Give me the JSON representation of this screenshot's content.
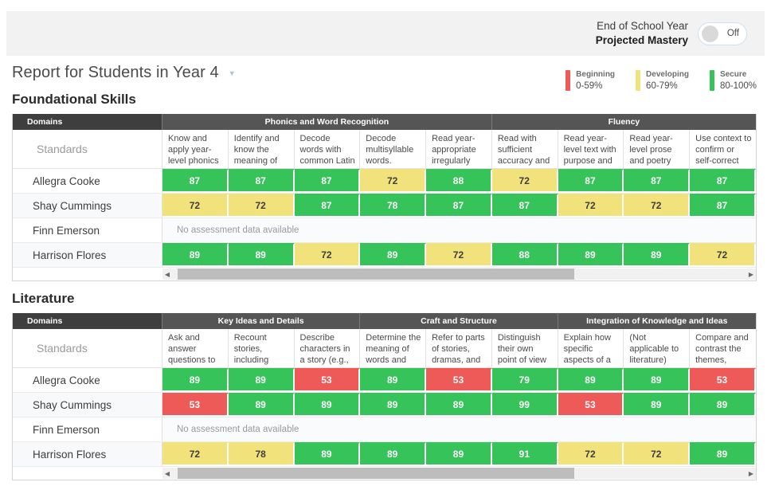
{
  "header": {
    "toggle_line1": "End of School Year",
    "toggle_line2": "Projected Mastery",
    "toggle_state": "Off"
  },
  "page_title": "Report for Students in Year 4",
  "legend": [
    {
      "name": "Beginning",
      "range": "0-59%",
      "color": "#ee5a58"
    },
    {
      "name": "Developing",
      "range": "60-79%",
      "color": "#f2e27c"
    },
    {
      "name": "Secure",
      "range": "80-100%",
      "color": "#35c35a"
    }
  ],
  "domains_header": "Domains",
  "standards_label": "Standards",
  "no_data_text": "No assessment data available",
  "sections": [
    {
      "title": "Foundational Skills",
      "groups": [
        {
          "label": "Phonics and Word Recognition",
          "span": 5
        },
        {
          "label": "Fluency",
          "span": 4
        }
      ],
      "standards": [
        "Know and apply year-level phonics",
        "Identify and know the meaning of",
        "Decode words with common Latin suffixes.",
        "Decode multisyllable words.",
        "Read year-appropriate irregularly",
        "Read with sufficient accuracy and",
        "Read year-level text with purpose and",
        "Read year-level prose and poetry",
        "Use context to confirm or self-correct"
      ],
      "rows": [
        {
          "name": "Allegra Cooke",
          "no_data": false,
          "scores": [
            87,
            87,
            87,
            72,
            88,
            72,
            87,
            87,
            87
          ],
          "levels": [
            "g",
            "g",
            "g",
            "y",
            "g",
            "y",
            "g",
            "g",
            "g"
          ]
        },
        {
          "name": "Shay Cummings",
          "no_data": false,
          "scores": [
            72,
            72,
            87,
            78,
            87,
            87,
            72,
            72,
            87
          ],
          "levels": [
            "y",
            "y",
            "g",
            "g",
            "g",
            "g",
            "y",
            "y",
            "g"
          ]
        },
        {
          "name": "Finn Emerson",
          "no_data": true,
          "scores": [],
          "levels": []
        },
        {
          "name": "Harrison Flores",
          "no_data": false,
          "scores": [
            89,
            89,
            72,
            89,
            72,
            88,
            89,
            89,
            72
          ],
          "levels": [
            "g",
            "g",
            "y",
            "g",
            "y",
            "g",
            "g",
            "g",
            "y"
          ]
        }
      ],
      "scroll": {
        "thumb_left_pct": 1,
        "thumb_width_pct": 69
      }
    },
    {
      "title": "Literature",
      "groups": [
        {
          "label": "Key Ideas and Details",
          "span": 3
        },
        {
          "label": "Craft and Structure",
          "span": 3
        },
        {
          "label": "Integration of Knowledge and Ideas",
          "span": 3
        }
      ],
      "standards": [
        "Ask and answer questions to",
        "Recount stories, including",
        "Describe characters in a story (e.g.,",
        "Determine the meaning of words and",
        "Refer to parts of stories, dramas, and",
        "Distinguish their own point of view",
        "Explain how specific aspects of a",
        "(Not applicable to literature)",
        "Compare and contrast the themes,"
      ],
      "rows": [
        {
          "name": "Allegra Cooke",
          "no_data": false,
          "scores": [
            89,
            89,
            53,
            89,
            53,
            79,
            89,
            89,
            53
          ],
          "levels": [
            "g",
            "g",
            "r",
            "g",
            "r",
            "g",
            "g",
            "g",
            "r"
          ]
        },
        {
          "name": "Shay Cummings",
          "no_data": false,
          "scores": [
            53,
            89,
            89,
            89,
            89,
            99,
            53,
            89,
            89
          ],
          "levels": [
            "r",
            "g",
            "g",
            "g",
            "g",
            "g",
            "r",
            "g",
            "g"
          ]
        },
        {
          "name": "Finn Emerson",
          "no_data": true,
          "scores": [],
          "levels": []
        },
        {
          "name": "Harrison Flores",
          "no_data": false,
          "scores": [
            72,
            78,
            89,
            89,
            89,
            91,
            72,
            72,
            89
          ],
          "levels": [
            "y",
            "y",
            "g",
            "g",
            "g",
            "g",
            "y",
            "y",
            "g"
          ]
        }
      ],
      "scroll": {
        "thumb_left_pct": 1,
        "thumb_width_pct": 69
      }
    }
  ]
}
